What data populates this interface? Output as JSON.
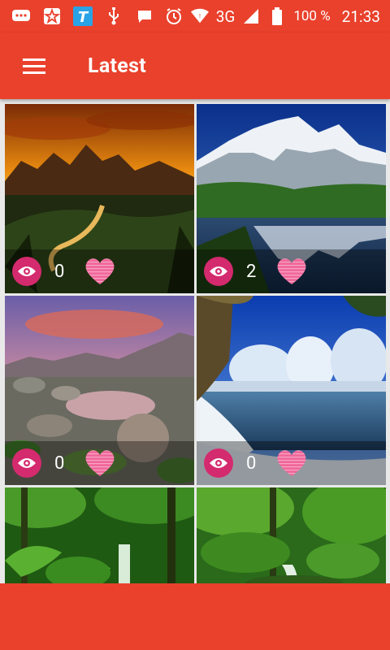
{
  "status_bar": {
    "network": "3G",
    "battery": "100 %",
    "time": "21:33"
  },
  "app_bar": {
    "title": "Latest"
  },
  "wallpapers": [
    {
      "scene": "golden mountain sunset",
      "views": "0"
    },
    {
      "scene": "snowy peaks reflected in lake",
      "views": "2"
    },
    {
      "scene": "rocky lake at sunset",
      "views": "0"
    },
    {
      "scene": "winter river with snowy trees",
      "views": "0"
    },
    {
      "scene": "tropical jungle waterfall",
      "views": ""
    },
    {
      "scene": "green forest stream",
      "views": ""
    }
  ],
  "colors": {
    "primary": "#e9412c",
    "eye_button": "#d42a6e",
    "heart": "#f0679a"
  }
}
